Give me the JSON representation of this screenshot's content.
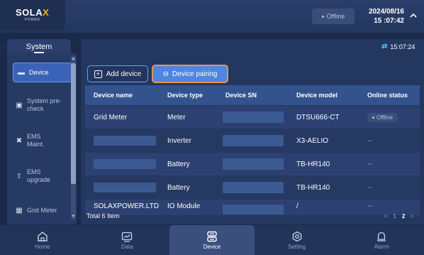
{
  "header": {
    "logo_main": "SOLA",
    "logo_x": "X",
    "logo_sub": "POWER",
    "status": "Offline",
    "date": "2024/08/16",
    "time": "15 :07:42"
  },
  "sidebar": {
    "tab_label": "System",
    "items": [
      {
        "label": "Device",
        "icon": "device-icon"
      },
      {
        "label": "System pre-check",
        "icon": "check-icon"
      },
      {
        "label": "EMS Maint.",
        "icon": "tools-icon"
      },
      {
        "label": "EMS upgrade",
        "icon": "upgrade-icon"
      },
      {
        "label": "Grid Meter",
        "icon": "meter-icon"
      }
    ]
  },
  "toolbar": {
    "refresh_time": "15:07:24",
    "add_device": "Add device",
    "device_pairing": "Device pairing"
  },
  "table": {
    "headers": [
      "Device name",
      "Device type",
      "Device SN",
      "Device model",
      "Online status"
    ],
    "rows": [
      {
        "name": "Grid Meter",
        "type": "Meter",
        "model": "DTSU666-CT",
        "status": "Offline"
      },
      {
        "name": "",
        "type": "Inverter",
        "model": "X3-AELIO",
        "status": "--"
      },
      {
        "name": "",
        "type": "Battery",
        "model": "TB-HR140",
        "status": "--"
      },
      {
        "name": "",
        "type": "Battery",
        "model": "TB-HR140",
        "status": "--"
      },
      {
        "name": "SOLAXPOWER.LTD",
        "type": "IO Module",
        "model": "/",
        "status": "--"
      }
    ],
    "total": "Total 6 Item",
    "pager": {
      "prev": "<",
      "page1": "1",
      "page2": "2",
      "next": ">"
    }
  },
  "bottom_nav": [
    {
      "label": "Home",
      "icon": "home-icon"
    },
    {
      "label": "Data",
      "icon": "chart-icon"
    },
    {
      "label": "Device",
      "icon": "device-icon"
    },
    {
      "label": "Setting",
      "icon": "gear-icon"
    },
    {
      "label": "Alarm",
      "icon": "bell-icon"
    }
  ]
}
